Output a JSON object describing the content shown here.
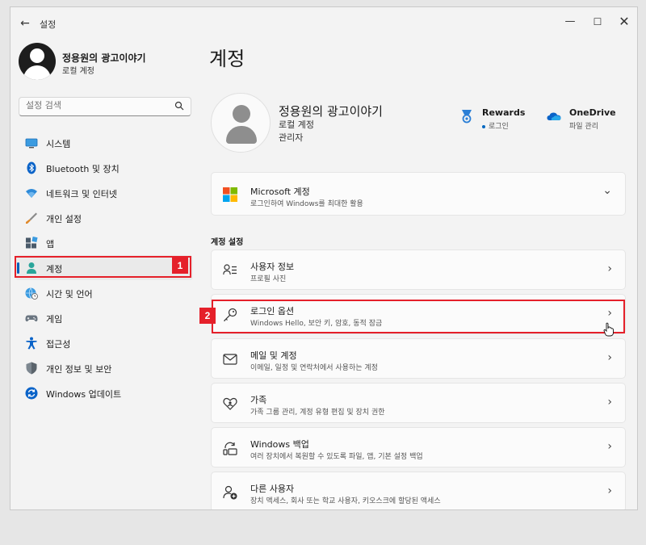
{
  "window": {
    "title": "설정",
    "back_glyph": "←",
    "min_glyph": "—",
    "max_glyph": "☐",
    "close_glyph": "✕"
  },
  "sidebar": {
    "user_name": "정용원의 광고이야기",
    "account_type": "로컬 계정",
    "search_placeholder": "설정 검색",
    "items": [
      {
        "label": "시스템",
        "icon": "monitor-icon"
      },
      {
        "label": "Bluetooth 및 장치",
        "icon": "bluetooth-icon"
      },
      {
        "label": "네트워크 및 인터넷",
        "icon": "wifi-icon"
      },
      {
        "label": "개인 설정",
        "icon": "brush-icon"
      },
      {
        "label": "앱",
        "icon": "apps-icon"
      },
      {
        "label": "계정",
        "icon": "account-icon",
        "active": true
      },
      {
        "label": "시간 및 언어",
        "icon": "globe-clock-icon"
      },
      {
        "label": "게임",
        "icon": "gamepad-icon"
      },
      {
        "label": "접근성",
        "icon": "accessibility-icon"
      },
      {
        "label": "개인 정보 및 보안",
        "icon": "shield-icon"
      },
      {
        "label": "Windows 업데이트",
        "icon": "update-icon"
      }
    ]
  },
  "annotations": {
    "badge_1": "1",
    "badge_2": "2"
  },
  "main": {
    "title": "계정",
    "profile": {
      "name": "정용원의 광고이야기",
      "account_type": "로컬 계정",
      "role": "관리자"
    },
    "services": {
      "rewards_title": "Rewards",
      "rewards_sub": "로그인",
      "onedrive_title": "OneDrive",
      "onedrive_sub": "파일 관리"
    },
    "ms_account": {
      "title": "Microsoft 계정",
      "subtitle": "로그인하여 Windows를 최대한 활용"
    },
    "section_label": "계정 설정",
    "settings": [
      {
        "title": "사용자 정보",
        "subtitle": "프로필 사진",
        "icon": "user-info-icon"
      },
      {
        "title": "로그인 옵션",
        "subtitle": "Windows Hello, 보안 키, 암호, 동적 잠금",
        "icon": "key-icon"
      },
      {
        "title": "메일 및 계정",
        "subtitle": "이메일, 일정 및 연락처에서 사용하는 계정",
        "icon": "mail-icon"
      },
      {
        "title": "가족",
        "subtitle": "가족 그룹 관리, 계정 유형 편집 및 장치 권한",
        "icon": "family-heart-icon"
      },
      {
        "title": "Windows 백업",
        "subtitle": "여러 장치에서 복원할 수 있도록 파일, 앱, 기본 설정 백업",
        "icon": "backup-icon"
      },
      {
        "title": "다른 사용자",
        "subtitle": "장치 액세스, 회사 또는 학교 사용자, 키오스크에 할당된 액세스",
        "icon": "add-user-icon"
      }
    ],
    "chevron_right": "›",
    "chevron_down": "⌄"
  },
  "colors": {
    "accent": "#005fb8",
    "highlight": "#e5202a"
  }
}
